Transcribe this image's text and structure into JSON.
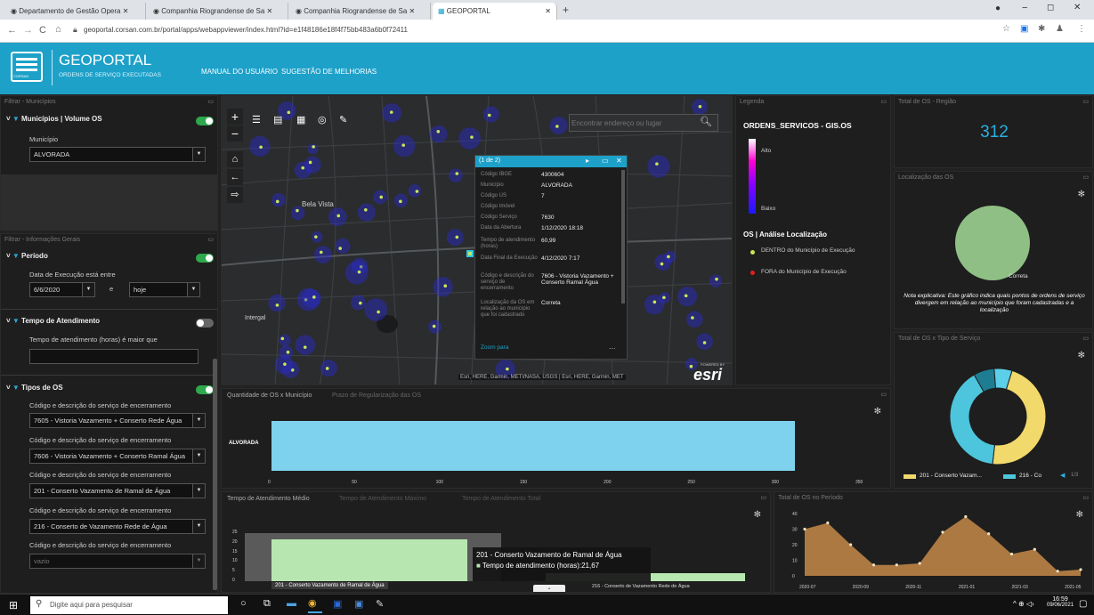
{
  "browser": {
    "tabs": [
      "Departamento de Gestão Opera",
      "Companhia Riograndense de Sa",
      "Companhia Riograndense de Sa",
      "GEOPORTAL"
    ],
    "new_tab": "+",
    "url": "geoportal.corsan.com.br/portal/apps/webappviewer/index.html?id=e1f48186e18f4f75bb483a6b0f72411"
  },
  "header": {
    "title": "GEOPORTAL",
    "subtitle": "ORDENS DE SERVIÇO EXECUTADAS",
    "logo_text": "CORSAN",
    "links": [
      "MANUAL DO USUÁRIO",
      "SUGESTÃO DE MELHORIAS"
    ]
  },
  "filters": {
    "municipio_panel": "Filtrar - Municípios",
    "municipio_filter": "Municípios | Volume OS",
    "municipio_label": "Município",
    "municipio_value": "ALVORADA",
    "info_panel": "Filtrar - Informações Gerais",
    "periodo_label": "Período",
    "periodo_desc": "Data de Execução está entre",
    "date_from": "6/6/2020",
    "and_sep": "e",
    "date_to": "hoje",
    "tempo_label": "Tempo de Atendimento",
    "tempo_desc": "Tempo de atendimento (horas) é maior que",
    "tipos_label": "Tipos de OS",
    "code_label": "Código e descrição do serviço de encerramento",
    "codes": [
      "7605 - Vistoria Vazamento + Conserto Rede Água",
      "7606 - Vistoria Vazamento + Conserto Ramal Água",
      "201 - Conserto Vazamento de Ramal de Água",
      "216 - Conserto de Vazamento Rede de Água",
      "vazio"
    ]
  },
  "map": {
    "search_placeholder": "Encontrar endereço ou lugar",
    "place_labels": [
      "Bela Vista",
      "Intergal"
    ],
    "attribution": "Esri, HERE, Garmin, METI/NASA, USGS | Esri, HERE, Garmin, MET",
    "powered": "POWERED BY",
    "esri": "esri",
    "popup": {
      "header": "(1 de 2)",
      "rows": [
        [
          "Código IBGE",
          "4300604"
        ],
        [
          "Município",
          "ALVORADA"
        ],
        [
          "Código US",
          "7"
        ],
        [
          "Código Imóvel",
          ""
        ],
        [
          "Código Serviço",
          "7630"
        ],
        [
          "Data da Abertura",
          "1/12/2020 18:18"
        ],
        [
          "Tempo de atendimento (horas)",
          "60,99"
        ],
        [
          "Data Final da Execução",
          "4/12/2020 7:17"
        ],
        [
          "Código e descrição do serviço de encerramento",
          "7606 - Vistoria Vazamento + Conserto Ramal Água"
        ],
        [
          "Localização da OS em relação ao município que foi cadastrado",
          "Correta"
        ]
      ],
      "zoom": "Zoom para",
      "more": "..."
    }
  },
  "legend": {
    "panel": "Legenda",
    "title": "ORDENS_SERVICOS - GIS.OS",
    "high": "Alto",
    "low": "Baixo",
    "section": "OS | Análise Localização",
    "items": [
      {
        "label": "DENTRO do Município de Execução",
        "color": "#c8e65a"
      },
      {
        "label": "FORA do Município de Execução",
        "color": "#e02020"
      }
    ]
  },
  "total_regiao": {
    "panel": "Total de OS - Região",
    "value": "312"
  },
  "localizacao": {
    "panel": "Localização das OS",
    "slice_label": "Correta",
    "note": "Nota explicativa: Este gráfico indica quais pontos de ordens de serviço divergem em relação ao município que foram cadastradas e a localização",
    "color": "#8fbf85"
  },
  "tipo_servico": {
    "panel": "Total de OS x Tipo de Serviço",
    "legend": [
      "201 - Conserto Vazam...",
      "216 - Co"
    ],
    "pager": "1/3"
  },
  "qtd_municipio": {
    "tabs": [
      "Quantidade de OS x Município",
      "Prazo de Regularização das OS"
    ],
    "category": "ALVORADA",
    "value": 312,
    "ticks": [
      "0",
      "50",
      "100",
      "150",
      "200",
      "250",
      "300",
      "350"
    ]
  },
  "tempo_medio": {
    "tabs": [
      "Tempo de Atendimento Médio",
      "Tempo de Atendimento Máximo",
      "Tempo de Atendimento Total"
    ],
    "ticks": [
      "25",
      "20",
      "15",
      "10",
      "5",
      "0"
    ],
    "bar_labels": [
      "201 - Conserto Vazamento de Ramal de Água",
      "216 - Conserto de Vazamento Rede de Água"
    ],
    "tooltip_title": "201 - Conserto Vazamento de Ramal de Água",
    "tooltip_value": "Tempo de atendimento (horas):21,67"
  },
  "periodo_chart": {
    "panel": "Total de OS no Período",
    "x": [
      "2020-07",
      "2020-09",
      "2020-11",
      "2021-01",
      "2021-03",
      "2021-05"
    ],
    "y_ticks": [
      "40",
      "30",
      "20",
      "10",
      "0"
    ]
  },
  "chart_data": [
    {
      "type": "bar",
      "title": "Quantidade de OS x Município",
      "categories": [
        "ALVORADA"
      ],
      "values": [
        312
      ],
      "xlim": [
        0,
        350
      ]
    },
    {
      "type": "bar",
      "title": "Tempo de Atendimento Médio",
      "categories": [
        "201 - Conserto Vazamento de Ramal de Água",
        "216 - Conserto de Vazamento Rede de Água"
      ],
      "values": [
        21.67,
        4
      ],
      "ylim": [
        0,
        25
      ]
    },
    {
      "type": "area",
      "title": "Total de OS no Período",
      "x": [
        "2020-06",
        "2020-07",
        "2020-08",
        "2020-09",
        "2020-10",
        "2020-11",
        "2020-12",
        "2021-01",
        "2021-02",
        "2021-03",
        "2021-04",
        "2021-05",
        "2021-06"
      ],
      "values": [
        30,
        34,
        20,
        7,
        7,
        8,
        28,
        38,
        27,
        14,
        17,
        3,
        4
      ],
      "ylim": [
        0,
        40
      ],
      "color": "#c58a4a"
    },
    {
      "type": "pie",
      "title": "Total de OS x Tipo de Serviço",
      "categories": [
        "201 - Conserto Vazamento de Ramal de Água",
        "216 - Conserto de Vazamento Rede de Água",
        "7605 - Vistoria Vazamento + Conserto Rede Água",
        "7606 - Vistoria Vazamento + Conserto Ramal Água"
      ],
      "values": [
        47,
        40,
        7,
        6
      ],
      "colors": [
        "#f2d96c",
        "#4cc5dd",
        "#1e7d93",
        "#5bd0e8"
      ],
      "donut": true
    },
    {
      "type": "pie",
      "title": "Localização das OS",
      "categories": [
        "Correta"
      ],
      "values": [
        312
      ]
    }
  ],
  "taskbar": {
    "search": "Digite aqui para pesquisar",
    "time": "16:59",
    "date": "09/06/2021"
  }
}
